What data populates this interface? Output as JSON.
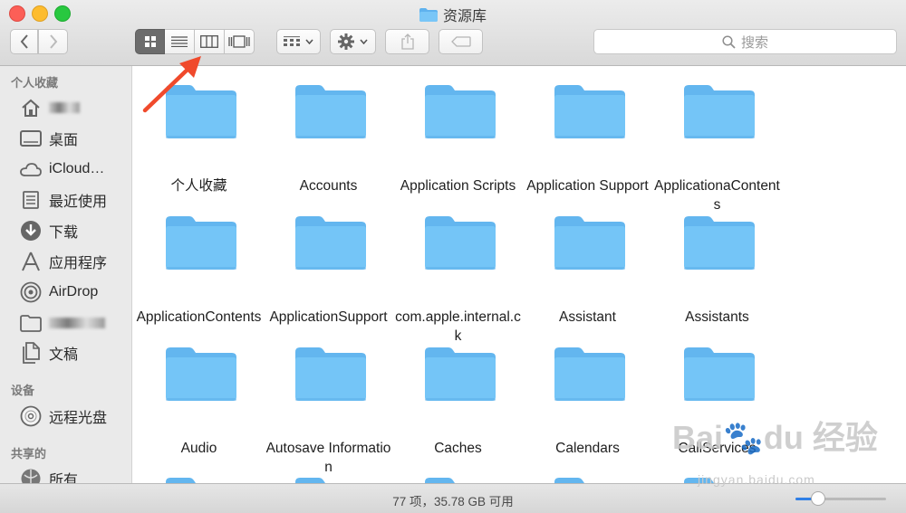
{
  "window": {
    "title": "资源库"
  },
  "toolbar": {
    "search_placeholder": "搜索"
  },
  "sidebar": {
    "sections": [
      {
        "title": "个人收藏",
        "items": [
          {
            "label": "",
            "icon": "home-icon",
            "blurred": true
          },
          {
            "label": "桌面",
            "icon": "desktop-icon"
          },
          {
            "label": "iCloud…",
            "icon": "cloud-icon"
          },
          {
            "label": "最近使用",
            "icon": "recents-icon"
          },
          {
            "label": "下载",
            "icon": "download-icon"
          },
          {
            "label": "应用程序",
            "icon": "applications-icon"
          },
          {
            "label": "AirDrop",
            "icon": "airdrop-icon"
          },
          {
            "label": "",
            "icon": "folder-icon",
            "blurred": true
          },
          {
            "label": "文稿",
            "icon": "documents-icon"
          }
        ]
      },
      {
        "title": "设备",
        "items": [
          {
            "label": "远程光盘",
            "icon": "disc-icon"
          }
        ]
      },
      {
        "title": "共享的",
        "items": [
          {
            "label": "所有…",
            "icon": "network-icon"
          }
        ]
      }
    ]
  },
  "files": [
    "个人收藏",
    "Accounts",
    "Application Scripts",
    "Application Support",
    "ApplicationaContents",
    "ApplicationContents",
    "ApplicationSupport",
    "com.apple.internal.ck",
    "Assistant",
    "Assistants",
    "Audio",
    "Autosave Information",
    "Caches",
    "Calendars",
    "CallServices"
  ],
  "status": {
    "text": "77 项，35.78 GB 可用",
    "zoom": 0.25
  },
  "watermark": {
    "brand": "Bai du 经验",
    "url": "jingyan.baidu.com"
  },
  "colors": {
    "folder": "#74c5f7",
    "folder_tab": "#63b6ef",
    "accent": "#2f7fe6",
    "arrow": "#f04a2c"
  }
}
